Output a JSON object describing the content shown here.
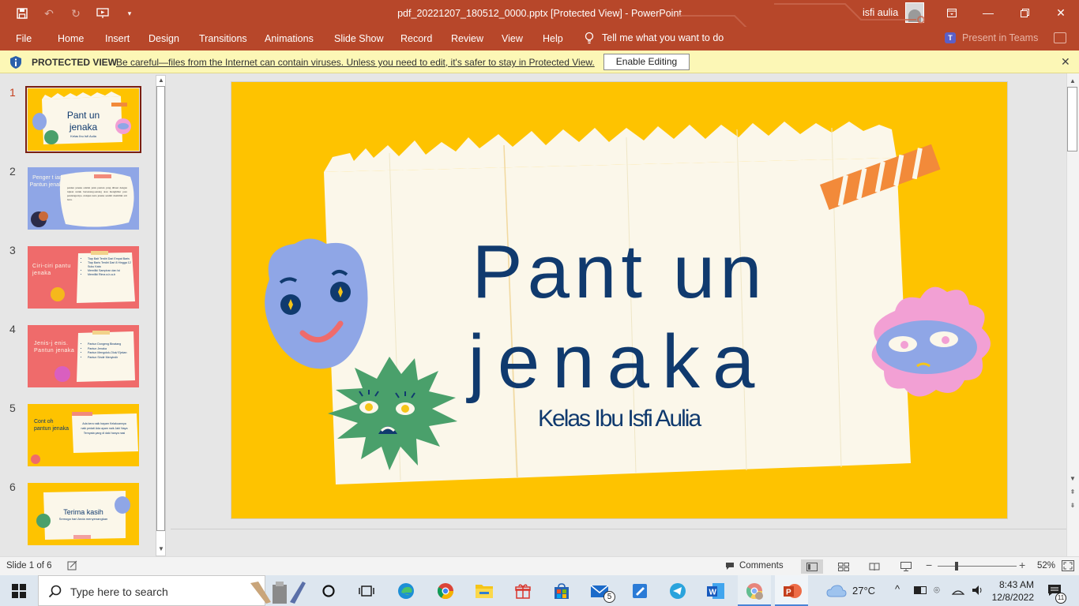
{
  "window": {
    "doc_title": "pdf_20221207_180512_0000.pptx [Protected View]  -  PowerPoint",
    "user_name": "isfi aulia"
  },
  "ribbon": {
    "tabs": [
      "File",
      "Home",
      "Insert",
      "Design",
      "Transitions",
      "Animations",
      "Slide Show",
      "Record",
      "Review",
      "View",
      "Help"
    ],
    "tell_me": "Tell me what you want to do",
    "present_teams": "Present in Teams"
  },
  "protected_view": {
    "title": "PROTECTED VIEW",
    "message": "Be careful—files from the Internet can contain viruses. Unless you need to edit, it's safer to stay in Protected View.",
    "enable_button": "Enable Editing"
  },
  "thumbnails": [
    {
      "num": "1",
      "title": "Pant un jenaka",
      "sub": "Kelas Ibu Isfi Aulia"
    },
    {
      "num": "2",
      "title": "Penger t ian Pantun jenaka",
      "body": "pantun jenaka adalah jenis pantun yang dibuat dengan tujuan untuk bersenang-senang atau menghibur para pendengarnya. Adapun kata jenaka sendiri memiliki arti lucu."
    },
    {
      "num": "3",
      "title": "Ciri-ciri pantu jenaka",
      "items": [
        "Tiap Bait Terdiri Dari Empat Baris",
        "Tiap Baris Terdiri Dari 8 Hingga 12 Suku Kata",
        "Memiliki Sampiran dan Isi",
        "Memiliki Rima a-b-a-b"
      ]
    },
    {
      "num": "4",
      "title": "Jenis-j enis. Pantun jenaka",
      "items": [
        "Pantun Dongeng Binatang",
        "Pantun Jenaka",
        "Pantun Mengolok-Olok/ Ejekan",
        "Pantun Sindir Menyindir"
      ]
    },
    {
      "num": "5",
      "title": "Cont oh pantun jenaka",
      "body": "Ada kera naik bayam Kelakuannya naik pedati Ada ayam naik Jabi Naya Ternyata yang di daki hanya nasi"
    },
    {
      "num": "6",
      "title": "Terima kasih",
      "sub": "Semoga hari Anda menyenangkan"
    }
  ],
  "slide": {
    "title_line1": "Pant un",
    "title_line2": "jenaka",
    "subtitle": "Kelas Ibu Isfi  Aulia"
  },
  "status": {
    "slide_info": "Slide 1 of 6",
    "comments": "Comments",
    "zoom": "52%"
  },
  "taskbar": {
    "search_placeholder": "Type here to search",
    "mail_badge": "5",
    "temperature": "27°C",
    "time": "8:43 AM",
    "date": "12/8/2022",
    "notification_count": "11"
  },
  "colors": {
    "accent": "#b7472a",
    "slide_bg": "#fec300",
    "title_text": "#103a6e",
    "pv_bar": "#fcf7b6"
  }
}
